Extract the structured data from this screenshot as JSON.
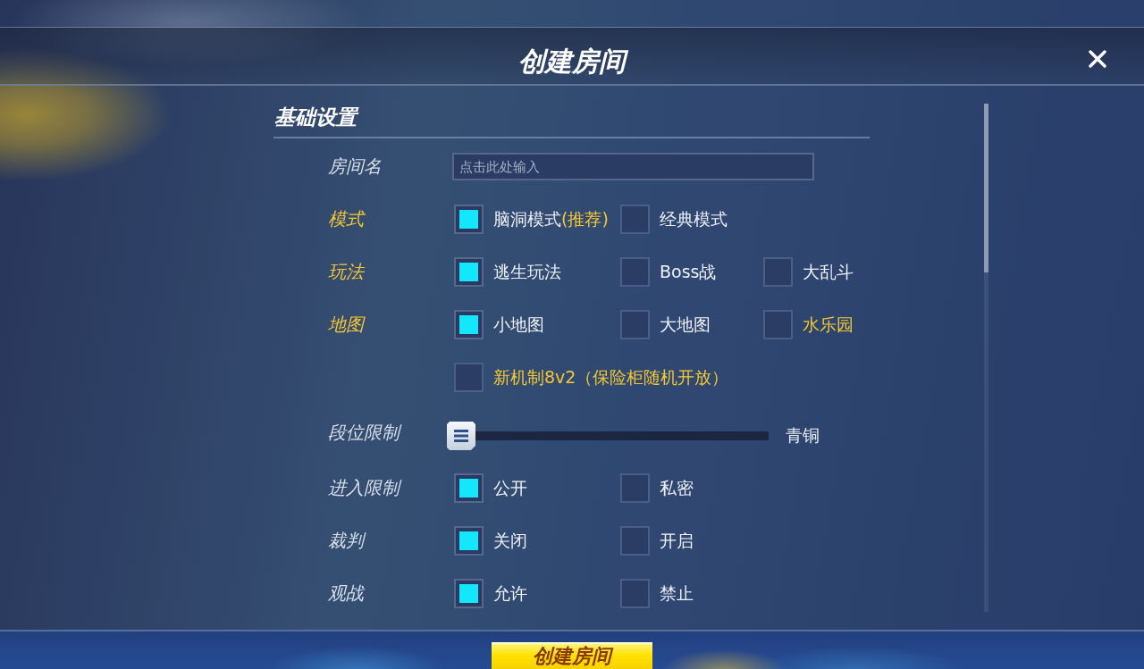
{
  "dialog": {
    "title": "创建房间"
  },
  "section": {
    "title": "基础设置"
  },
  "rows": [
    {
      "kind": "text_input",
      "label": "房间名",
      "highlight": false,
      "placeholder": "点击此处输入"
    },
    {
      "kind": "checkboxes",
      "label": "模式",
      "highlight": true,
      "options": [
        {
          "label": "脑洞模式",
          "note": "(推荐)",
          "checked": true,
          "highlight": false
        },
        {
          "label": "经典模式",
          "checked": false,
          "highlight": false
        }
      ]
    },
    {
      "kind": "checkboxes",
      "label": "玩法",
      "highlight": true,
      "options": [
        {
          "label": "逃生玩法",
          "checked": true,
          "highlight": false
        },
        {
          "label": "Boss战",
          "checked": false,
          "highlight": false
        },
        {
          "label": "大乱斗",
          "checked": false,
          "highlight": false
        }
      ]
    },
    {
      "kind": "checkboxes",
      "label": "地图",
      "highlight": true,
      "options": [
        {
          "label": "小地图",
          "checked": true,
          "highlight": false
        },
        {
          "label": "大地图",
          "checked": false,
          "highlight": false
        },
        {
          "label": "水乐园",
          "checked": false,
          "highlight": true
        }
      ]
    },
    {
      "kind": "checkboxes",
      "options": [
        {
          "label": "新机制8v2（保险柜随机开放）",
          "checked": false,
          "highlight": true
        }
      ]
    },
    {
      "kind": "slider",
      "label": "段位限制",
      "highlight": false,
      "level": 0,
      "reading": "青铜"
    },
    {
      "kind": "checkboxes",
      "label": "进入限制",
      "highlight": false,
      "options": [
        {
          "label": "公开",
          "checked": true,
          "highlight": false
        },
        {
          "label": "私密",
          "checked": false,
          "highlight": false
        }
      ]
    },
    {
      "kind": "checkboxes",
      "label": "裁判",
      "highlight": false,
      "options": [
        {
          "label": "关闭",
          "checked": true,
          "highlight": false
        },
        {
          "label": "开启",
          "checked": false,
          "highlight": false
        }
      ]
    },
    {
      "kind": "checkboxes",
      "label": "观战",
      "highlight": false,
      "options": [
        {
          "label": "允许",
          "checked": true,
          "highlight": false
        },
        {
          "label": "禁止",
          "checked": false,
          "highlight": false
        }
      ]
    }
  ],
  "footer": {
    "button": "创建房间"
  }
}
